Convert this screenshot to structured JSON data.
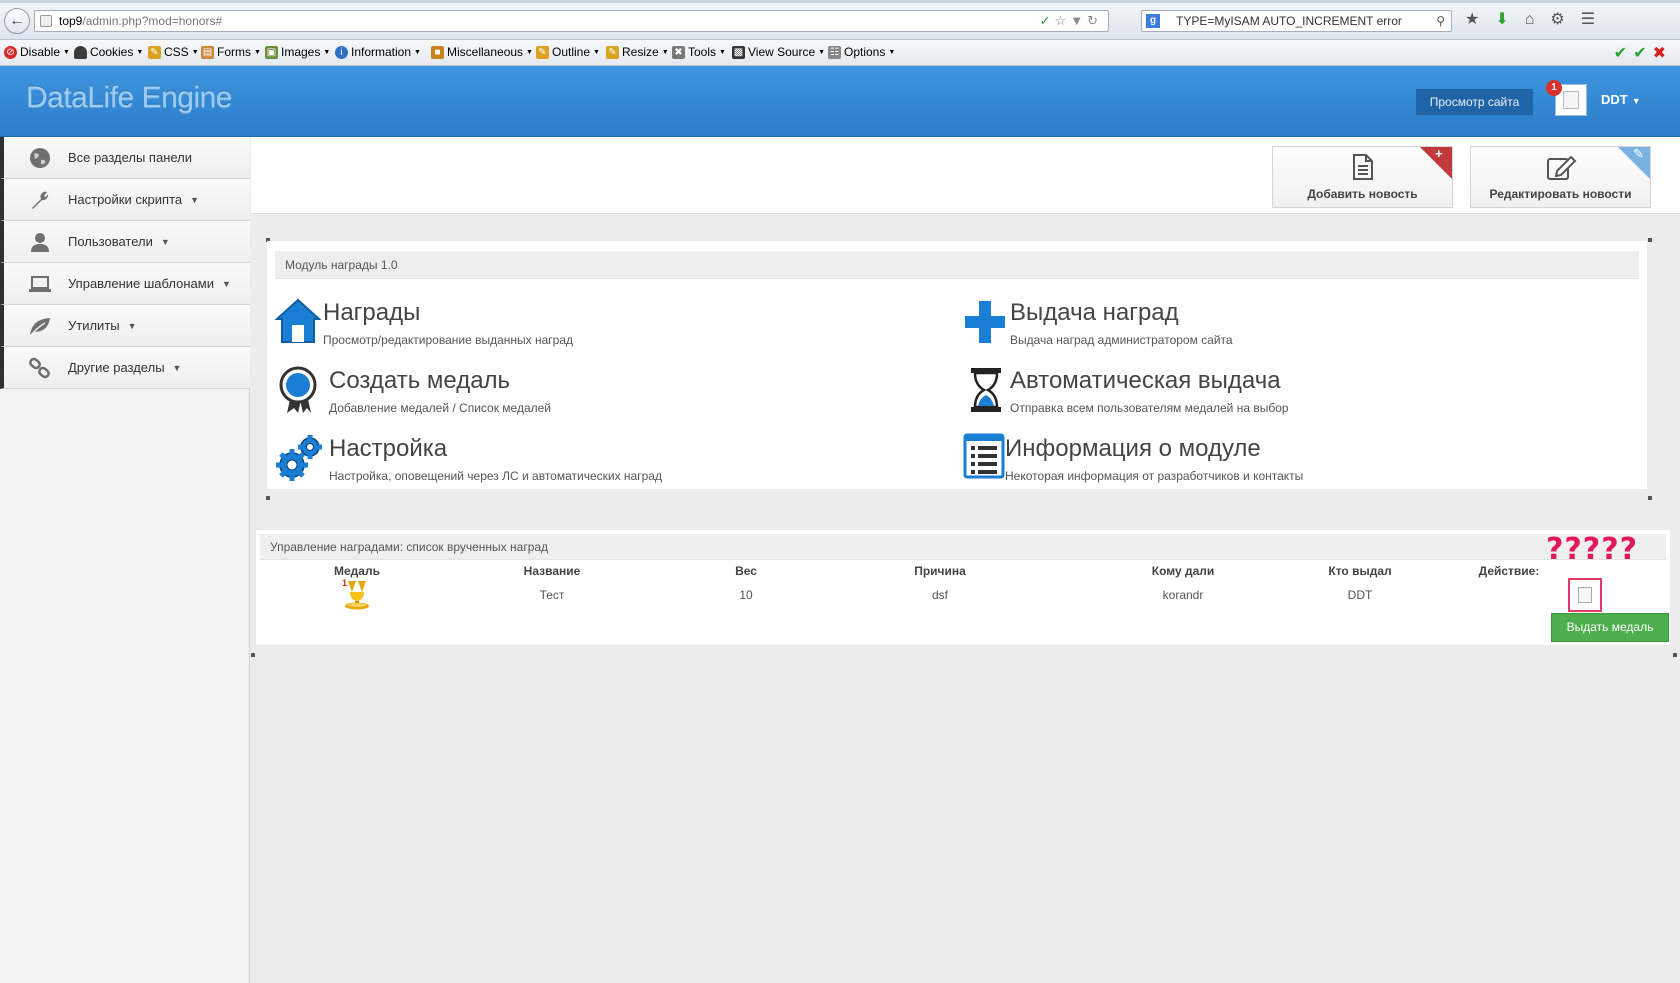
{
  "browser": {
    "url_host": "top9",
    "url_path": "/admin.php?mod=honors#",
    "search_text": "TYPE=MyISAM AUTO_INCREMENT error",
    "search_engine": "g"
  },
  "devbar": {
    "items": [
      "Disable",
      "Cookies",
      "CSS",
      "Forms",
      "Images",
      "Information",
      "Miscellaneous",
      "Outline",
      "Resize",
      "Tools",
      "View Source",
      "Options"
    ]
  },
  "header": {
    "logo": "DataLife Engine",
    "view_site": "Просмотр сайта",
    "notifications": "1",
    "user": "DDT"
  },
  "sidebar": {
    "items": [
      {
        "label": "Все разделы панели",
        "icon": "globe-icon",
        "has_menu": false
      },
      {
        "label": "Настройки скрипта",
        "icon": "wrench-icon",
        "has_menu": true
      },
      {
        "label": "Пользователи",
        "icon": "user-icon",
        "has_menu": true
      },
      {
        "label": "Управление шаблонами",
        "icon": "laptop-icon",
        "has_menu": true
      },
      {
        "label": "Утилиты",
        "icon": "leaf-icon",
        "has_menu": true
      },
      {
        "label": "Другие разделы",
        "icon": "link-icon",
        "has_menu": true
      }
    ]
  },
  "actions": {
    "add_news": "Добавить новость",
    "edit_news": "Редактировать новости"
  },
  "module": {
    "title": "Модуль награды 1.0",
    "tiles": [
      {
        "title": "Награды",
        "desc": "Просмотр/редактирование выданных наград",
        "icon": "home-icon"
      },
      {
        "title": "Выдача наград",
        "desc": "Выдача наград администратором сайта",
        "icon": "plus-icon"
      },
      {
        "title": "Создать медаль",
        "desc": "Добавление медалей / Список медалей",
        "icon": "medal-icon"
      },
      {
        "title": "Автоматическая выдача",
        "desc": "Отправка всем пользователям медалей на выбор",
        "icon": "hourglass-icon"
      },
      {
        "title": "Настройка",
        "desc": "Настройка, оповещений через ЛС и автоматических наград",
        "icon": "gears-icon"
      },
      {
        "title": "Информация о модуле",
        "desc": "Некоторая информация от разработчиков и контакты",
        "icon": "list-icon"
      }
    ]
  },
  "awards": {
    "title": "Управление наградами: список врученных наград",
    "headers": [
      "Медаль",
      "Название",
      "Вес",
      "Причина",
      "Кому дали",
      "Кто выдал",
      "Действие:"
    ],
    "rows": [
      {
        "name": "Тест",
        "weight": "10",
        "reason": "dsf",
        "to": "korandr",
        "by": "DDT",
        "medal_badge": "1"
      }
    ],
    "give_button": "Выдать медаль",
    "annotation": "?????"
  },
  "colors": {
    "header": "#3a8fdc",
    "green_button": "#4cae4c",
    "annotation": "#e2185a",
    "icon_blue": "#1a7fd4"
  }
}
